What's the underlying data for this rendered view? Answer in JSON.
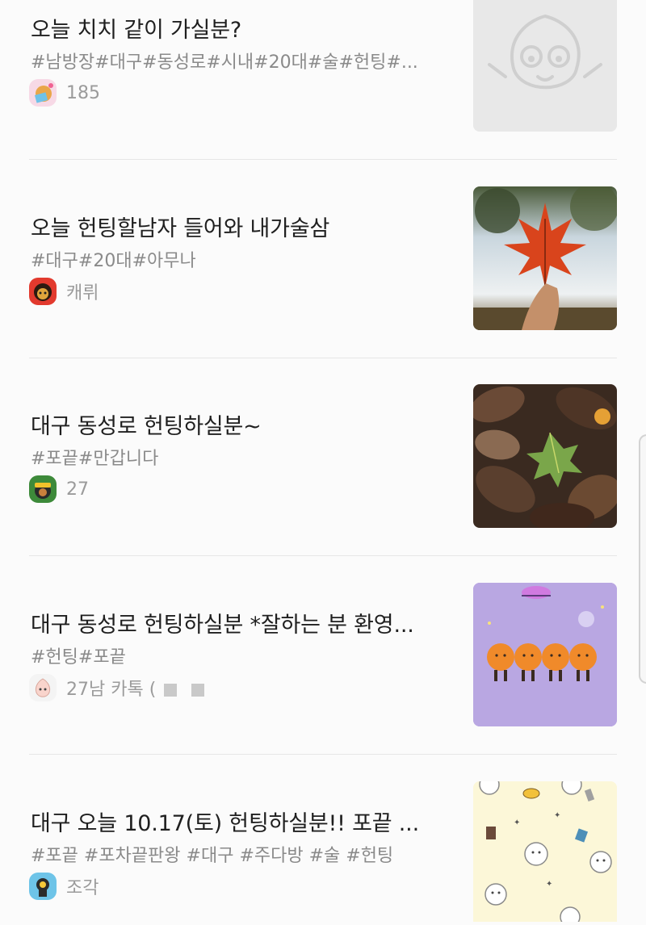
{
  "posts": [
    {
      "title": "오늘 치치 같이 가실분?",
      "tags": "#남방장#대구#동성로#시내#20대#술#헌팅#...",
      "meta": "185",
      "avatar_icon": "ryan-book-avatar-icon",
      "thumb_icon": "apeach-placeholder-icon"
    },
    {
      "title": "오늘 헌팅할남자 들어와 내가술삼",
      "tags": "#대구#20대#아무나",
      "meta": "캐뤼",
      "avatar_icon": "character-red-avatar-icon",
      "thumb_icon": "maple-leaf-photo-icon"
    },
    {
      "title": "대구 동성로 헌팅하실분~",
      "tags": "#포끝#만갑니다",
      "meta": "27",
      "avatar_icon": "character-green-avatar-icon",
      "thumb_icon": "autumn-leaves-photo-icon"
    },
    {
      "title": "대구 동성로 헌팅하실분 *잘하는 분 환영...",
      "tags": "#헌팅#포끝",
      "meta": "27남 카톡 (",
      "avatar_icon": "apeach-avatar-icon",
      "thumb_icon": "ryan-dancers-illustration-icon"
    },
    {
      "title": "대구 오늘 10.17(토) 헌팅하실분!! 포끝 ...",
      "tags": "#포끝 #포차끝판왕 #대구 #주다방 #술 #헌팅",
      "meta": "조각",
      "avatar_icon": "character-blue-avatar-icon",
      "thumb_icon": "pattern-illustration-icon"
    }
  ],
  "colors": {
    "background": "#fbfbfb",
    "title": "#1f1f1f",
    "tags": "#8a8a8a",
    "meta": "#9b9b9b",
    "divider": "#e6e6e6"
  }
}
